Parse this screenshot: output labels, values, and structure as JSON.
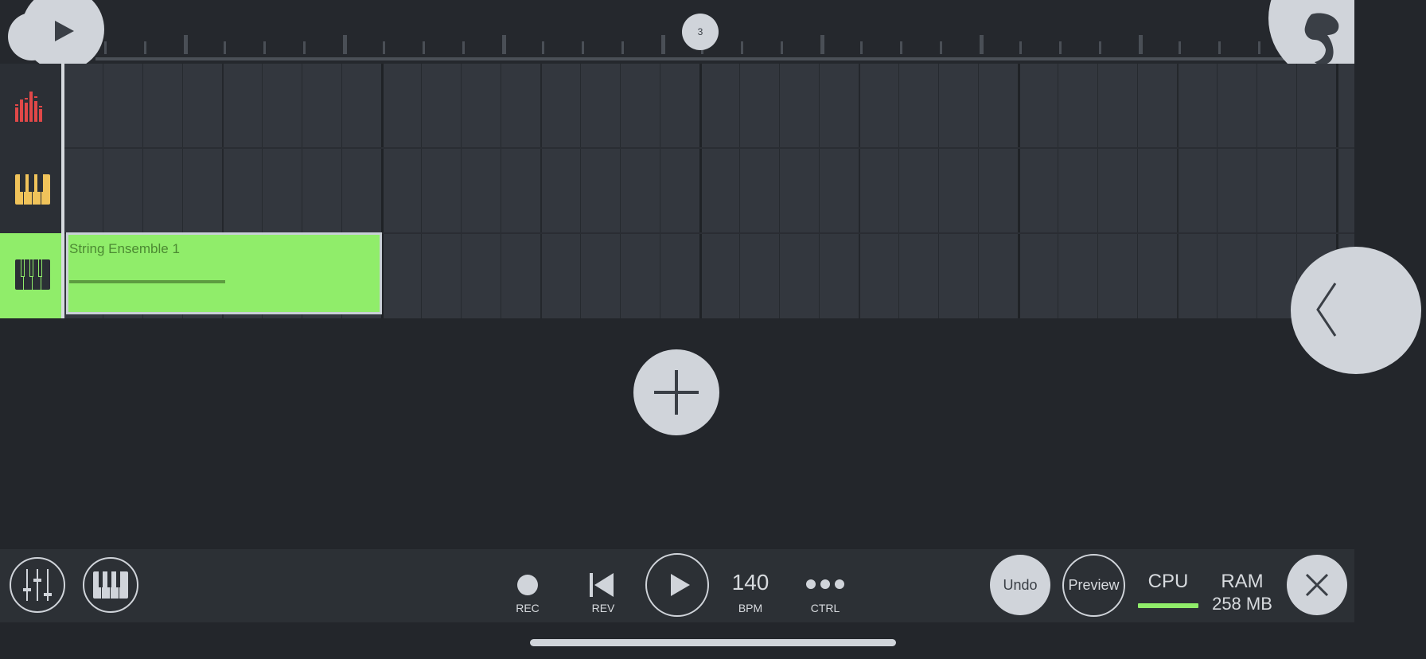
{
  "ruler": {
    "position_marker": "3"
  },
  "tracks": [
    {
      "name": "playlist-track-1",
      "icon": "mixer-bars-icon",
      "icon_color": "#e04848"
    },
    {
      "name": "playlist-track-2",
      "icon": "piano-keys-icon",
      "icon_color": "#f0c35a"
    },
    {
      "name": "playlist-track-3",
      "icon": "piano-keys-icon",
      "icon_color": "#2b2f35",
      "active": true
    }
  ],
  "clip": {
    "label": "String Ensemble 1",
    "color": "#90ed6a"
  },
  "toolbar": {
    "rec_label": "REC",
    "rev_label": "REV",
    "bpm_value": "140",
    "bpm_label": "BPM",
    "ctrl_label": "CTRL",
    "undo_label": "Undo",
    "preview_label": "Preview",
    "cpu_label": "CPU",
    "cpu_meter_color": "#90ed6a",
    "ram_label": "RAM",
    "ram_value": "258 MB"
  },
  "icons": {
    "play_top": "play-icon",
    "logo": "fruit-logo-icon",
    "collapse": "chevron-left-icon",
    "add": "plus-icon",
    "mixer": "mixer-sliders-icon",
    "piano": "piano-keys-icon",
    "rev": "skip-back-icon",
    "play": "play-icon",
    "more": "more-dots-icon",
    "close": "close-icon"
  }
}
